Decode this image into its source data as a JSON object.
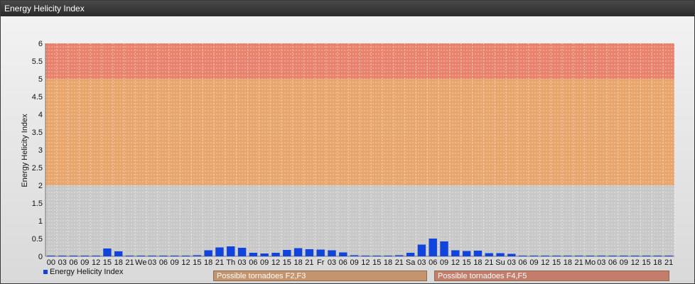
{
  "window": {
    "title": "Energy Helicity Index"
  },
  "colors": {
    "bar": "#1144dd",
    "band_f4f5": "#e9826c",
    "band_f2f3": "#e8a66c",
    "band_low": "#c8c8c8",
    "label_f2f3_bg": "#c6946c",
    "label_f4f5_bg": "#c47d6a"
  },
  "bands": [
    {
      "label": "Possible tornadoes F2,F3",
      "from": 2,
      "to": 5
    },
    {
      "label": "Possible tornadoes F4,F5",
      "from": 5,
      "to": 6
    }
  ],
  "chart_data": {
    "type": "bar",
    "ylabel": "Energy Helicity Index",
    "ylim": [
      0,
      6
    ],
    "yticks": [
      "0",
      "0.5",
      "1",
      "1.5",
      "2",
      "2.5",
      "3",
      "3.5",
      "4",
      "4.5",
      "5",
      "5.5",
      "6"
    ],
    "categories": [
      "00",
      "03",
      "06",
      "09",
      "12",
      "15",
      "18",
      "21",
      "We",
      "03",
      "06",
      "09",
      "12",
      "15",
      "18",
      "21",
      "Th",
      "03",
      "06",
      "09",
      "12",
      "15",
      "18",
      "21",
      "Fr",
      "03",
      "06",
      "09",
      "12",
      "15",
      "18",
      "21",
      "Sa",
      "03",
      "06",
      "09",
      "12",
      "15",
      "18",
      "21",
      "Su",
      "03",
      "06",
      "09",
      "12",
      "15",
      "18",
      "21",
      "Mo",
      "03",
      "06",
      "09",
      "12",
      "15",
      "18",
      "21"
    ],
    "series": [
      {
        "name": "Energy Helicity Index",
        "values": [
          0.02,
          0.02,
          0.02,
          0.02,
          0.02,
          0.22,
          0.14,
          0.02,
          0.02,
          0.02,
          0.02,
          0.02,
          0.02,
          0.03,
          0.17,
          0.25,
          0.28,
          0.24,
          0.1,
          0.08,
          0.1,
          0.18,
          0.23,
          0.2,
          0.19,
          0.17,
          0.11,
          0.03,
          0.02,
          0.02,
          0.02,
          0.03,
          0.1,
          0.33,
          0.5,
          0.42,
          0.17,
          0.15,
          0.16,
          0.09,
          0.09,
          0.07,
          0.02,
          0.02,
          0.02,
          0.02,
          0.02,
          0.02,
          0.02,
          0.02,
          0.02,
          0.02,
          0.02,
          0.02,
          0.02,
          0.02
        ]
      }
    ],
    "grid": true,
    "legend": "bottom-left"
  }
}
